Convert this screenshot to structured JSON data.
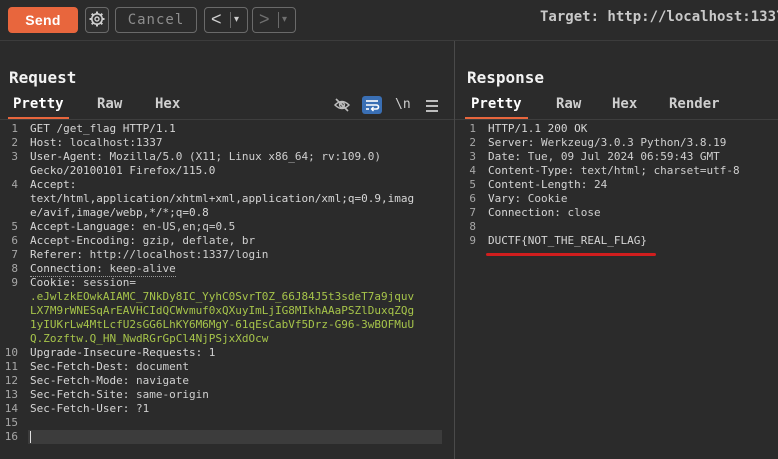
{
  "toolbar": {
    "send_label": "Send",
    "cancel_label": "Cancel",
    "back_glyph": "<",
    "forward_glyph": ">",
    "dropdown_glyph": "▾",
    "target_text": "Target: http://localhost:1337"
  },
  "request": {
    "title": "Request",
    "tabs": [
      "Pretty",
      "Raw",
      "Hex"
    ],
    "active_tab": "Pretty",
    "newline_toggle": "\\n",
    "lines": [
      {
        "n": "1",
        "text": "GET /get_flag HTTP/1.1"
      },
      {
        "n": "2",
        "key": "Host:",
        "value": " localhost:1337"
      },
      {
        "n": "3",
        "key": "User-Agent:",
        "value": " Mozilla/5.0 (X11; Linux x86_64; rv:109.0)"
      },
      {
        "n": "",
        "text": "Gecko/20100101 Firefox/115.0"
      },
      {
        "n": "4",
        "key": "Accept:",
        "value": ""
      },
      {
        "n": "",
        "text": "text/html,application/xhtml+xml,application/xml;q=0.9,imag"
      },
      {
        "n": "",
        "text": "e/avif,image/webp,*/*;q=0.8"
      },
      {
        "n": "5",
        "key": "Accept-Language:",
        "value": " en-US,en;q=0.5"
      },
      {
        "n": "6",
        "key": "Accept-Encoding:",
        "value": " gzip, deflate, br"
      },
      {
        "n": "7",
        "key": "Referer:",
        "value": " http://localhost:1337/login"
      },
      {
        "n": "8",
        "key": "Connection:",
        "value": " keep-alive"
      },
      {
        "n": "9",
        "key": "Cookie:",
        "value": " session="
      },
      {
        "n": "",
        "cookie": ".eJwlzkEOwkAIAMC_7NkDy8IC_YyhC0SvrT0Z_66J84J5t3sdeT7a9jquv"
      },
      {
        "n": "",
        "cookie": "LX7M9rWNESqArEAVHCIdQCWvmuf0xQXuyImLjIG8MIkhAAaPSZlDuxqZQg"
      },
      {
        "n": "",
        "cookie": "1yIUKrLw4MtLcfU2sGG6LhKY6M6MgY-61qEsCabVf5Drz-G96-3wBOFMuU"
      },
      {
        "n": "",
        "cookie": "Q.Zozftw.Q_HN_NwdRGrGpCl4NjPSjxXdOcw"
      },
      {
        "n": "10",
        "key": "Upgrade-Insecure-Requests:",
        "value": " 1"
      },
      {
        "n": "11",
        "key": "Sec-Fetch-Dest:",
        "value": " document"
      },
      {
        "n": "12",
        "key": "Sec-Fetch-Mode:",
        "value": " navigate"
      },
      {
        "n": "13",
        "key": "Sec-Fetch-Site:",
        "value": " same-origin"
      },
      {
        "n": "14",
        "key": "Sec-Fetch-User:",
        "value": " ?1"
      },
      {
        "n": "15",
        "text": ""
      },
      {
        "n": "16",
        "text": ""
      }
    ]
  },
  "response": {
    "title": "Response",
    "tabs": [
      "Pretty",
      "Raw",
      "Hex",
      "Render"
    ],
    "active_tab": "Pretty",
    "lines": [
      {
        "n": "1",
        "text": "HTTP/1.1 200 OK"
      },
      {
        "n": "2",
        "key": "Server:",
        "value": " Werkzeug/3.0.3 Python/3.8.19"
      },
      {
        "n": "3",
        "key": "Date:",
        "value": " Tue, 09 Jul 2024 06:59:43 GMT"
      },
      {
        "n": "4",
        "key": "Content-Type:",
        "value": " text/html; charset=utf-8"
      },
      {
        "n": "5",
        "key": "Content-Length:",
        "value": " 24"
      },
      {
        "n": "6",
        "key": "Vary:",
        "value": " Cookie"
      },
      {
        "n": "7",
        "key": "Connection:",
        "value": " close"
      },
      {
        "n": "8",
        "text": ""
      },
      {
        "n": "9",
        "text": "DUCTF{NOT_THE_REAL_FLAG}"
      }
    ]
  },
  "colors": {
    "accent": "#e8663d",
    "cookie": "#a6c44a",
    "highlight_underline": "#d01e1e",
    "wrap_toggle": "#3a6fb4"
  }
}
